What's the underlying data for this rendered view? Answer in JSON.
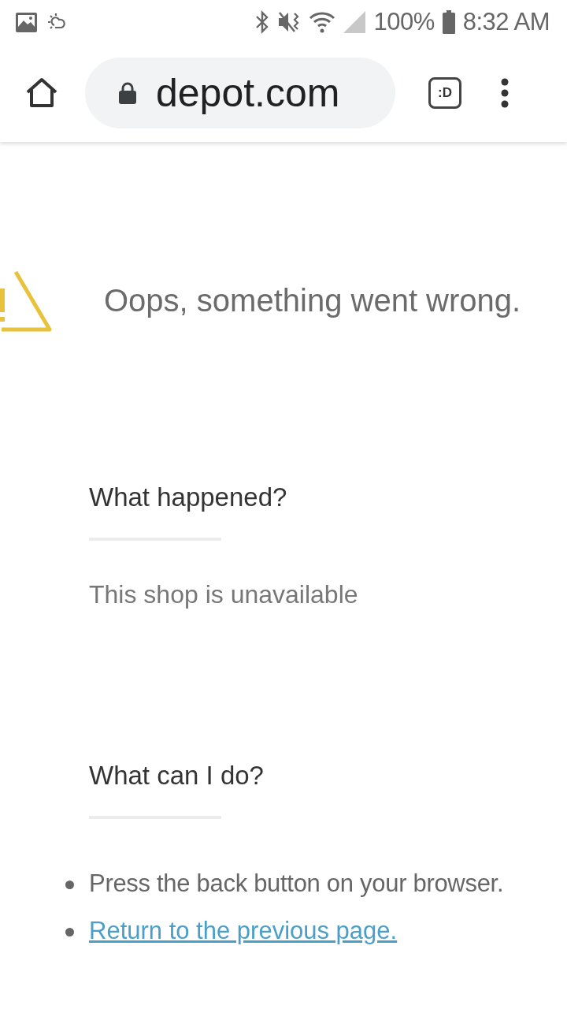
{
  "status_bar": {
    "battery": "100%",
    "time": "8:32 AM"
  },
  "browser": {
    "url": "depot.com",
    "tab_switcher": ":D"
  },
  "page": {
    "title": "Oops, something went wrong.",
    "sections": [
      {
        "heading": "What happened?",
        "items": [
          {
            "kind": "text",
            "text": "This shop is unavailable"
          }
        ]
      },
      {
        "heading": "What can I do?",
        "items": [
          {
            "kind": "bullet",
            "text": "Press the back button on your browser."
          },
          {
            "kind": "link",
            "text": "Return to the previous page."
          }
        ]
      }
    ]
  }
}
